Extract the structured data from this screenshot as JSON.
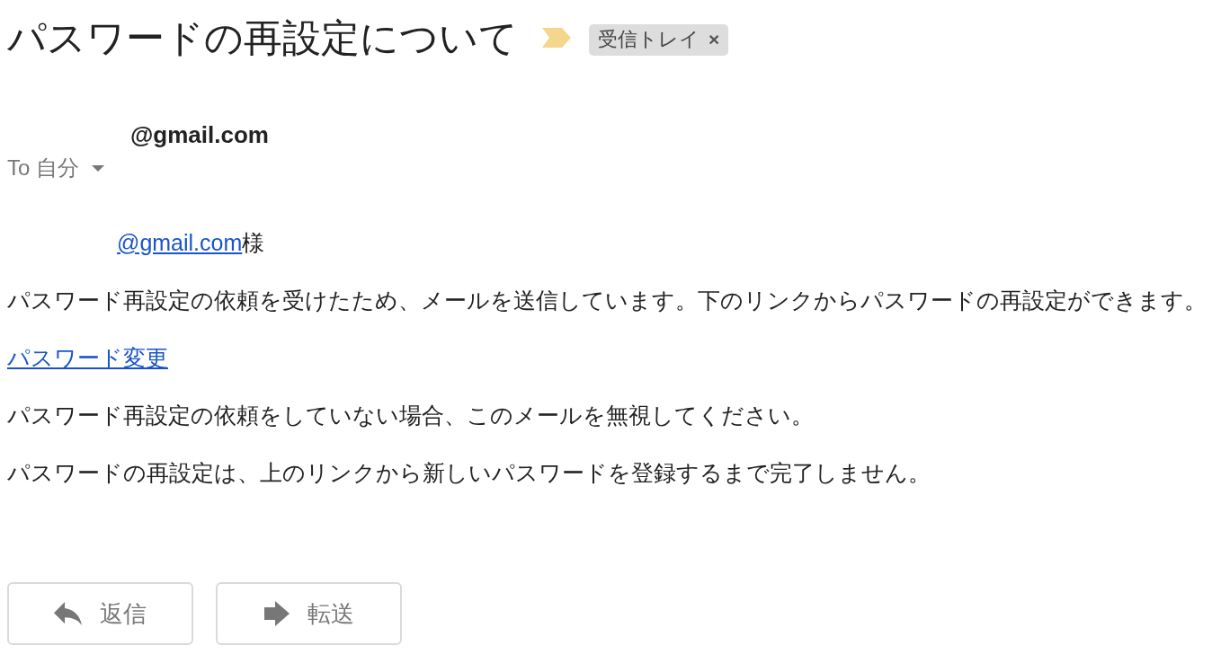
{
  "subject": {
    "title": "パスワードの再設定について",
    "important": true,
    "label": {
      "text": "受信トレイ",
      "remove": "×"
    }
  },
  "header": {
    "sender": "@gmail.com",
    "recipient": "To 自分"
  },
  "body": [
    {
      "kind": "greeting",
      "link": "@gmail.com",
      "suffix": "様"
    },
    {
      "kind": "text",
      "text": "パスワード再設定の依頼を受けたため、メールを送信しています。下のリンクからパスワードの再設定ができます。"
    },
    {
      "kind": "link",
      "text": "パスワード変更"
    },
    {
      "kind": "text",
      "text": "パスワード再設定の依頼をしていない場合、このメールを無視してください。"
    },
    {
      "kind": "text",
      "text": "パスワードの再設定は、上のリンクから新しいパスワードを登録するまで完了しません。"
    }
  ],
  "actions": [
    {
      "kind": "reply",
      "label": "返信"
    },
    {
      "kind": "forward",
      "label": "転送"
    }
  ]
}
